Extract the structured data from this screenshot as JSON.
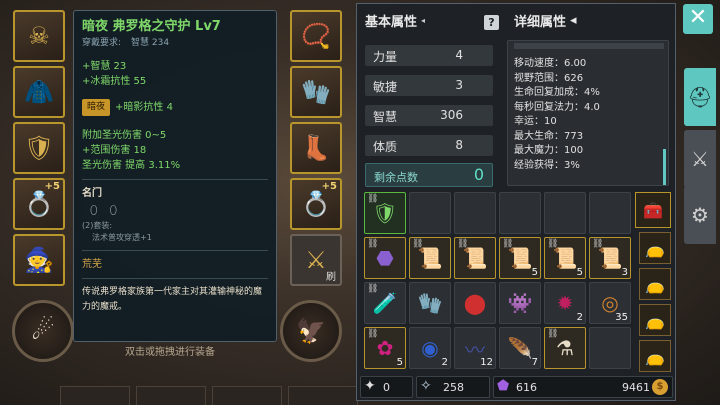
{
  "tooltip": {
    "title": "暗夜 弗罗格之守护 Lv7",
    "req_label": "穿戴要求:",
    "req_value": "智慧 234",
    "attr1": "+智慧 23",
    "attr2": "+冰霜抗性 55",
    "night_tag": "暗夜",
    "night_attr": "+暗影抗性 4",
    "dmg1": "附加圣光伤害 0~5",
    "dmg2": "+范围伤害 18",
    "dmg3": "圣光伤害 提高 3.11%",
    "gem_title": "名门",
    "set_title": "(2)套装:",
    "set_bonus": "法术普攻穿透+1",
    "desolate": "荒芜",
    "description": "传说弗罗格家族第一代家主对其灌输神秘的魔力的魔戒。"
  },
  "hint": "双击或拖拽进行装备",
  "equip": {
    "right_slot_5_caption": "刷"
  },
  "panel": {
    "basic_title": "基本属性",
    "detail_title": "详细属性",
    "stats": [
      {
        "label": "力量",
        "value": "4"
      },
      {
        "label": "敏捷",
        "value": "3"
      },
      {
        "label": "智慧",
        "value": "306"
      },
      {
        "label": "体质",
        "value": "8"
      }
    ],
    "remain_label": "剩余点数",
    "remain_value": "0",
    "details": [
      "移动速度：6.00",
      "视野范围：626",
      "生命回复加成：4%",
      "每秒回复法力：4.0",
      "幸运：10",
      "最大生命：773",
      "最大魔力：100",
      "经验获得：3%"
    ]
  },
  "bag": {
    "counts": {
      "r1c5": "5",
      "r1c6": "5",
      "r1c7": "3",
      "r2c6": "2",
      "r2c7": "35",
      "r3c1": "5",
      "r3c2": "2",
      "r3c3": "12",
      "r3c4": "7"
    }
  },
  "currency": {
    "c1": "0",
    "c2": "258",
    "c3": "616",
    "gold": "9461"
  },
  "icons": {
    "close": "close-icon",
    "helmet": "helmet-tab-icon",
    "crossed": "weapons-tab-icon",
    "gear": "settings-tab-icon"
  },
  "colors": {
    "accent": "#5ec8c0",
    "gold": "#b8962c",
    "green_text": "#7fd86a"
  }
}
